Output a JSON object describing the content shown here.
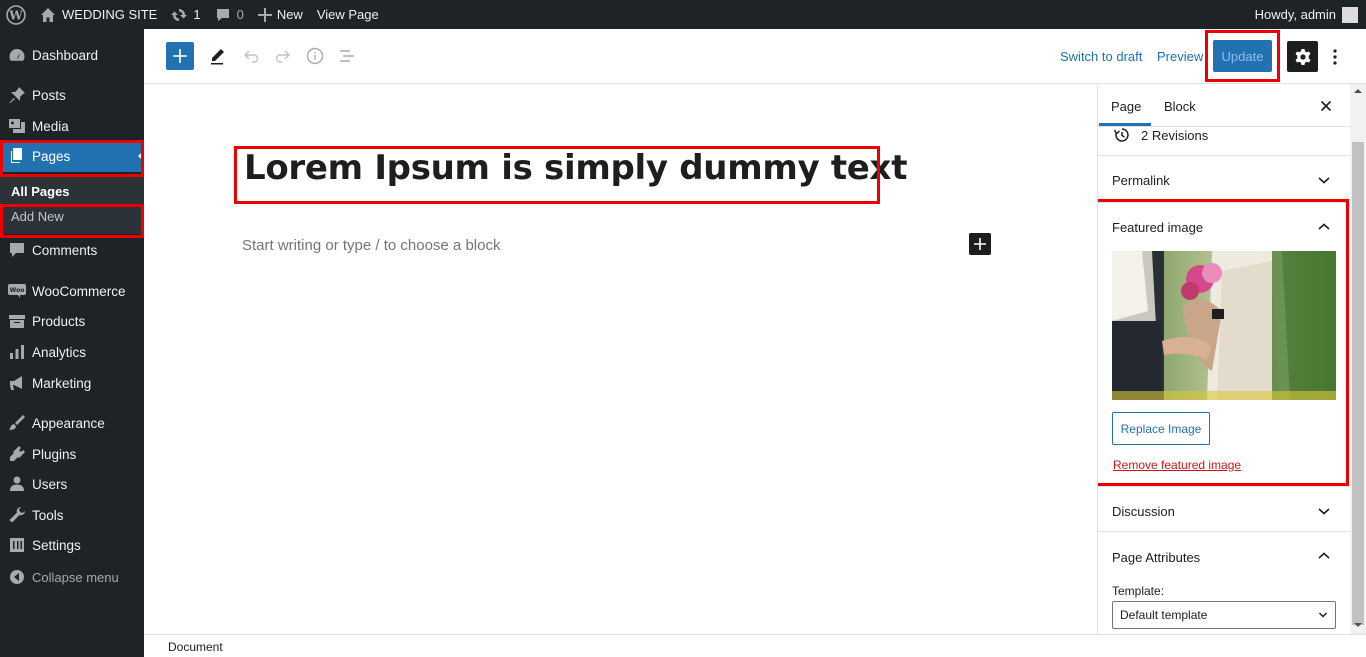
{
  "adminbar": {
    "site_name": "WEDDING SITE",
    "updates_count": "1",
    "comments_count": "0",
    "new_label": "New",
    "view_page_label": "View Page",
    "howdy": "Howdy, admin"
  },
  "sidebar": {
    "items": [
      {
        "label": "Dashboard",
        "icon": "dashboard-icon"
      },
      {
        "label": "Posts",
        "icon": "pin-icon"
      },
      {
        "label": "Media",
        "icon": "media-icon"
      },
      {
        "label": "Pages",
        "icon": "pages-icon"
      },
      {
        "label": "Comments",
        "icon": "comment-icon"
      },
      {
        "label": "WooCommerce",
        "icon": "woocommerce-icon"
      },
      {
        "label": "Products",
        "icon": "archive-icon"
      },
      {
        "label": "Analytics",
        "icon": "bar-chart-icon"
      },
      {
        "label": "Marketing",
        "icon": "megaphone-icon"
      },
      {
        "label": "Appearance",
        "icon": "paintbrush-icon"
      },
      {
        "label": "Plugins",
        "icon": "plugin-icon"
      },
      {
        "label": "Users",
        "icon": "user-icon"
      },
      {
        "label": "Tools",
        "icon": "wrench-icon"
      },
      {
        "label": "Settings",
        "icon": "settings-sliders-icon"
      }
    ],
    "submenu": {
      "all_pages": "All Pages",
      "add_new": "Add New"
    },
    "collapse_label": "Collapse menu"
  },
  "header": {
    "switch_to_draft": "Switch to draft",
    "preview": "Preview",
    "update": "Update"
  },
  "editor": {
    "title": "Lorem Ipsum is simply dummy text",
    "placeholder": "Start writing or type / to choose a block"
  },
  "settings_panel": {
    "tabs": [
      "Page",
      "Block"
    ],
    "revisions": "2 Revisions",
    "permalink": "Permalink",
    "featured_image": "Featured image",
    "replace_image": "Replace Image",
    "remove_featured_image": "Remove featured image",
    "discussion": "Discussion",
    "page_attributes": "Page Attributes",
    "template_label": "Template:",
    "template_value": "Default template"
  },
  "footer": {
    "breadcrumb": "Document"
  },
  "colors": {
    "accent": "#2271b1",
    "admin_dark": "#1d2327",
    "highlight_red": "#e00000",
    "danger": "#cc1818"
  }
}
